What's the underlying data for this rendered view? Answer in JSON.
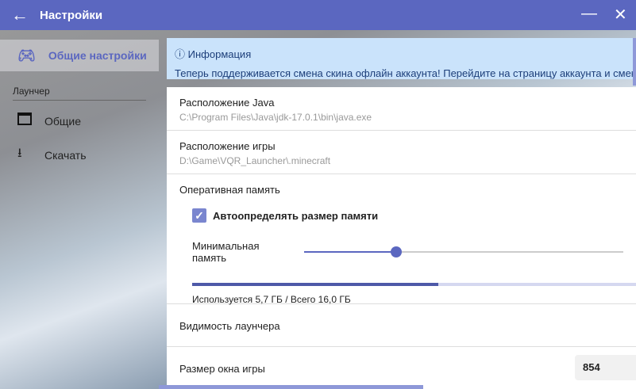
{
  "window": {
    "title": "Настройки",
    "minimize": "—",
    "close": "✕",
    "back": "←"
  },
  "sidebar": {
    "selected": "Общие настройки",
    "group": "Лаунчер",
    "items": [
      {
        "label": "Общие"
      },
      {
        "label": "Скачать"
      }
    ]
  },
  "info": {
    "title": "Информация",
    "text": "Теперь поддерживается смена скина офлайн аккаунта! Перейдите на страницу аккаунта и смените скин"
  },
  "settings": {
    "java": {
      "label": "Расположение Java",
      "value": "C:\\Program Files\\Java\\jdk-17.0.1\\bin\\java.exe"
    },
    "game": {
      "label": "Расположение игры",
      "value": "D:\\Game\\VQR_Launcher\\.minecraft"
    },
    "ram": {
      "label": "Оперативная память",
      "auto_label": "Автоопределять размер памяти",
      "auto_checked": true,
      "min_label": "Минимальная память",
      "min_slider_fraction": 0.29,
      "used_gb": 5.7,
      "total_gb": 16.0,
      "usage_text": "Используется 5,7 ГБ / Всего 16,0 ГБ"
    },
    "visibility": {
      "label": "Видимость лаунчера"
    },
    "window_size": {
      "label": "Размер окна игры",
      "width": "854"
    }
  },
  "colors": {
    "accent": "#5b67c0",
    "info_bg": "#cae3fb"
  }
}
